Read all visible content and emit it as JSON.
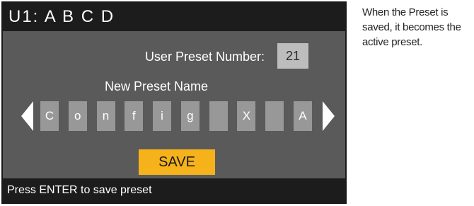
{
  "screen": {
    "title": "U1: A B C D",
    "preset_number_label": "User Preset Number:",
    "preset_number_value": "21",
    "name_heading": "New Preset Name",
    "name_chars": [
      "C",
      "o",
      "n",
      "f",
      "i",
      "g",
      "",
      "X",
      "",
      "A"
    ],
    "save_label": "SAVE",
    "status_text": "Press ENTER to save preset"
  },
  "caption": {
    "text": "When the Preset is saved, it becomes the active preset."
  },
  "colors": {
    "screen_bg": "#5a5a5a",
    "bar_bg": "#1c1c1c",
    "slot_bg": "#989898",
    "save_bg": "#f6b21a"
  },
  "icons": {
    "left": "arrow-left-icon",
    "right": "arrow-right-icon"
  }
}
